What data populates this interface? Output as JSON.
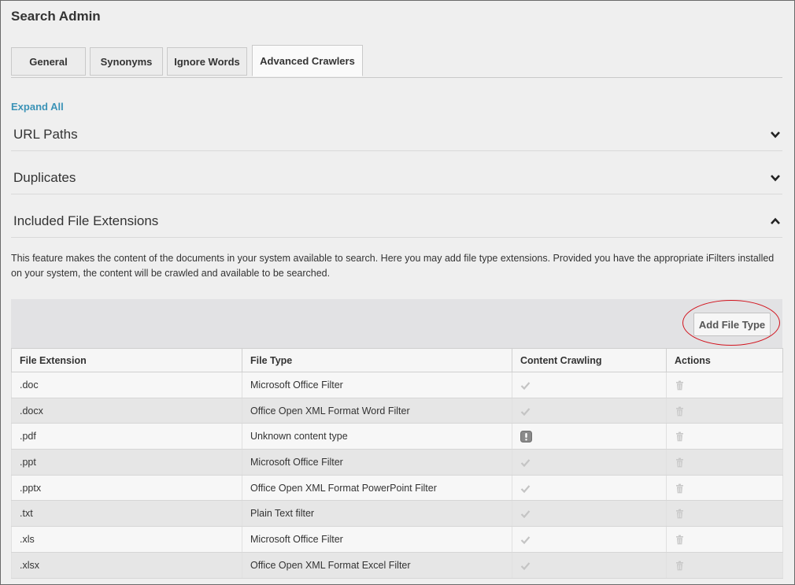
{
  "page": {
    "title": "Search Admin"
  },
  "tabs": [
    {
      "label": "General"
    },
    {
      "label": "Synonyms"
    },
    {
      "label": "Ignore Words"
    },
    {
      "label": "Advanced Crawlers",
      "active": true
    }
  ],
  "expand_all_label": "Expand All",
  "sections": [
    {
      "title": "URL Paths",
      "state": "collapsed"
    },
    {
      "title": "Duplicates",
      "state": "collapsed"
    },
    {
      "title": "Included File Extensions",
      "state": "expanded"
    }
  ],
  "description": "This feature makes the content of the documents in your system available to search. Here you may add file type extensions. Provided you have the appropriate iFilters installed on your system, the content will be crawled and available to be searched.",
  "toolbar": {
    "add_file_type_label": "Add File Type"
  },
  "table": {
    "columns": [
      "File Extension",
      "File Type",
      "Content Crawling",
      "Actions"
    ],
    "rows": [
      {
        "extension": ".doc",
        "file_type": "Microsoft Office Filter",
        "crawling": "check-icon"
      },
      {
        "extension": ".docx",
        "file_type": "Office Open XML Format Word Filter",
        "crawling": "check-icon"
      },
      {
        "extension": ".pdf",
        "file_type": "Unknown content type",
        "crawling": "warning-icon"
      },
      {
        "extension": ".ppt",
        "file_type": "Microsoft Office Filter",
        "crawling": "check-icon"
      },
      {
        "extension": ".pptx",
        "file_type": "Office Open XML Format PowerPoint Filter",
        "crawling": "check-icon"
      },
      {
        "extension": ".txt",
        "file_type": "Plain Text filter",
        "crawling": "check-icon"
      },
      {
        "extension": ".xls",
        "file_type": "Microsoft Office Filter",
        "crawling": "check-icon"
      },
      {
        "extension": ".xlsx",
        "file_type": "Office Open XML Format Excel Filter",
        "crawling": "check-icon"
      }
    ],
    "action_icon": "trash-icon"
  },
  "colors": {
    "link": "#3b93b7",
    "highlight_ring": "#d2141e",
    "toolbar_bg": "#e2e2e4",
    "icon_gray": "#c4c4c4"
  }
}
